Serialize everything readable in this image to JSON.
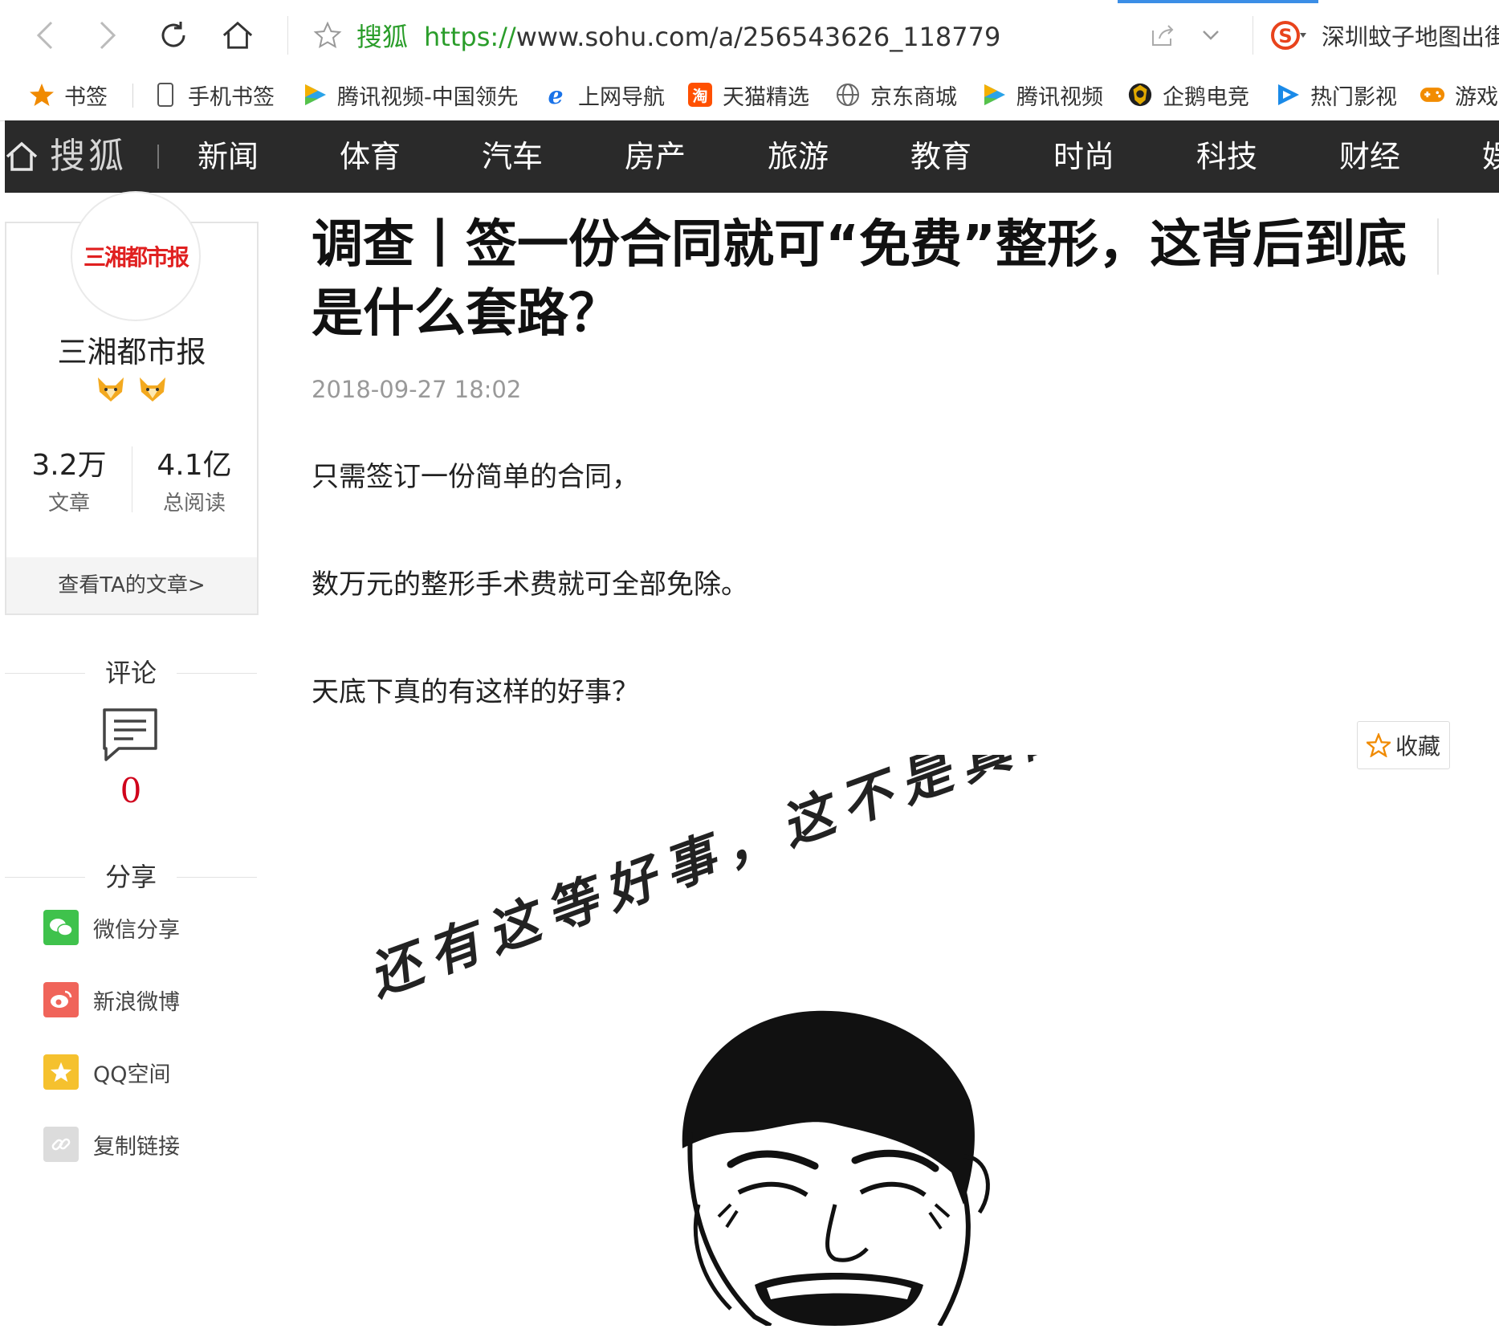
{
  "browser": {
    "site_label": "搜狐",
    "url_scheme": "https://",
    "url_rest": "www.sohu.com/a/256543626_118779",
    "search_text": "深圳蚊子地图出街"
  },
  "bookmarks": {
    "items": [
      {
        "label": "书签",
        "icon": "star-icon"
      },
      {
        "label": "手机书签",
        "icon": "phone-icon"
      },
      {
        "label": "腾讯视频-中国领先",
        "icon": "tencent-video-icon"
      },
      {
        "label": "上网导航",
        "icon": "ie-icon"
      },
      {
        "label": "天猫精选",
        "icon": "tmall-icon"
      },
      {
        "label": "京东商城",
        "icon": "globe-icon"
      },
      {
        "label": "腾讯视频",
        "icon": "tencent-video-icon"
      },
      {
        "label": "企鹅电竞",
        "icon": "penguin-esports-icon"
      },
      {
        "label": "热门影视",
        "icon": "play-icon"
      },
      {
        "label": "游戏",
        "icon": "gamepad-icon"
      }
    ]
  },
  "sitenav": {
    "logo": "搜狐",
    "items": [
      "新闻",
      "体育",
      "汽车",
      "房产",
      "旅游",
      "教育",
      "时尚",
      "科技",
      "财经",
      "娱"
    ]
  },
  "author": {
    "avatar_text": "三湘都市报",
    "name": "三湘都市报",
    "articles_count": "3.2万",
    "articles_label": "文章",
    "reads_count": "4.1亿",
    "reads_label": "总阅读",
    "view_link": "查看TA的文章>"
  },
  "comments": {
    "title": "评论",
    "count": "0"
  },
  "share": {
    "title": "分享",
    "items": [
      {
        "label": "微信分享",
        "color": "#3fc24c"
      },
      {
        "label": "新浪微博",
        "color": "#f0645a"
      },
      {
        "label": "QQ空间",
        "color": "#f5c12e"
      },
      {
        "label": "复制链接",
        "color": "#dcdcdc"
      }
    ]
  },
  "article": {
    "headline": "调查丨签一份合同就可“免费”整形，这背后到底是什么套路？",
    "date": "2018-09-27 18:02",
    "paragraphs": [
      "只需签订一份简单的合同，",
      "数万元的整形手术费就可全部免除。",
      "天底下真的有这样的好事？"
    ],
    "favorite_label": "收藏",
    "meme_caption": "还有这等好事，这不是真的吧"
  },
  "colors": {
    "nav_bg": "#2a2a2a",
    "url_green": "#2a9d2a",
    "accent_red": "#d0021b"
  }
}
